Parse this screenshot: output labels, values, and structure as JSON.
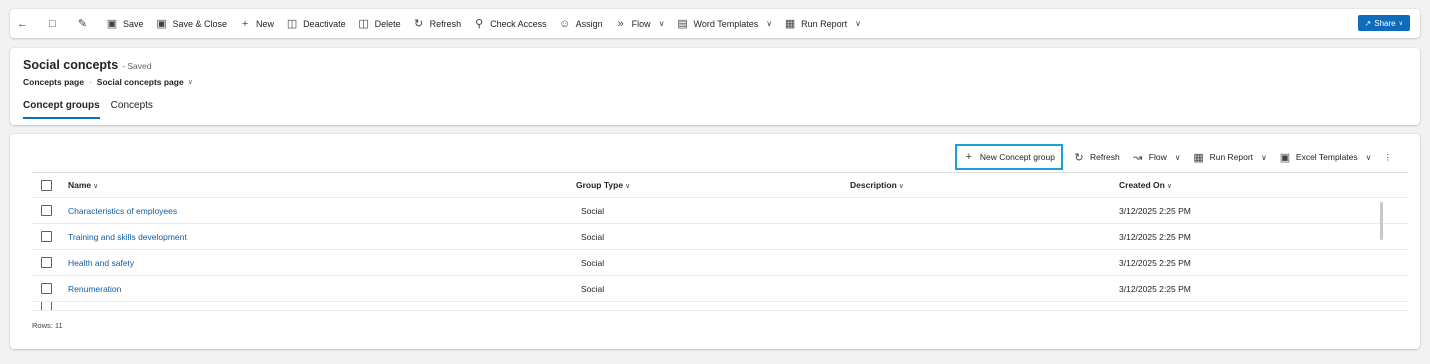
{
  "commandbar": {
    "items": [
      {
        "label": "Save",
        "icon": "save-icon"
      },
      {
        "label": "Save & Close",
        "icon": "save-close-icon"
      },
      {
        "label": "New",
        "icon": "plus-icon"
      },
      {
        "label": "Deactivate",
        "icon": "deactivate-icon"
      },
      {
        "label": "Delete",
        "icon": "trash-icon"
      },
      {
        "label": "Refresh",
        "icon": "refresh-icon"
      },
      {
        "label": "Check Access",
        "icon": "check-access-icon"
      },
      {
        "label": "Assign",
        "icon": "assign-icon"
      },
      {
        "label": "Flow",
        "icon": "flow-icon"
      },
      {
        "label": "Word Templates",
        "icon": "word-icon"
      },
      {
        "label": "Run Report",
        "icon": "report-icon"
      }
    ],
    "share_label": "Share"
  },
  "header": {
    "title": "Social concepts",
    "status": "- Saved",
    "breadcrumb": [
      "Concepts page",
      "Social concepts page"
    ],
    "tabs": [
      "Concept groups",
      "Concepts"
    ]
  },
  "grid": {
    "toolbar": {
      "new_group": "New Concept group",
      "refresh": "Refresh",
      "flow": "Flow",
      "run_report": "Run Report",
      "excel_templates": "Excel Templates"
    },
    "columns": [
      "Name",
      "Group Type",
      "Description",
      "Created On"
    ],
    "rows": [
      {
        "name": "Characteristics of employees",
        "group_type": "Social",
        "description": "",
        "created_on": "3/12/2025 2:25 PM"
      },
      {
        "name": "Training and skills development",
        "group_type": "Social",
        "description": "",
        "created_on": "3/12/2025 2:25 PM"
      },
      {
        "name": "Health and safety",
        "group_type": "Social",
        "description": "",
        "created_on": "3/12/2025 2:25 PM"
      },
      {
        "name": "Renumeration",
        "group_type": "Social",
        "description": "",
        "created_on": "3/12/2025 2:25 PM"
      }
    ],
    "rows_label": "Rows: 11"
  },
  "colors": {
    "accent": "#0f6cbd",
    "highlight": "#1aa0d8",
    "link": "#115ea3"
  }
}
